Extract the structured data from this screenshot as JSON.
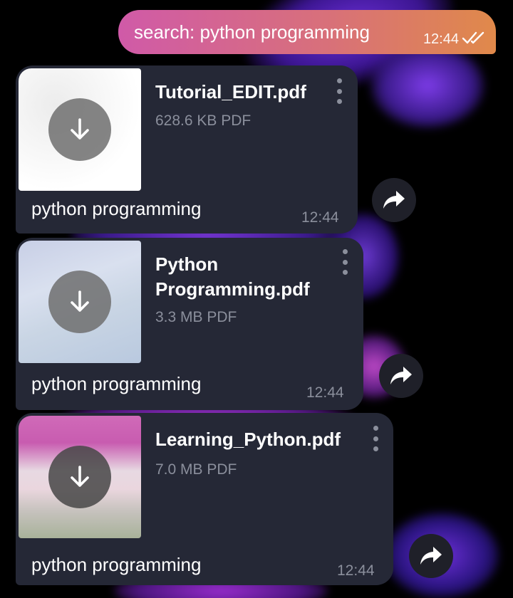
{
  "outgoing": {
    "text": "search: python programming",
    "time": "12:44",
    "status_icon": "double-check-icon"
  },
  "documents": [
    {
      "file_name": "Tutorial_EDIT.pdf",
      "file_info": "628.6 KB PDF",
      "caption": "python programming",
      "time": "12:44",
      "thumb_style": "white"
    },
    {
      "file_name_line1": "Python",
      "file_name_line2": "Programming.pdf",
      "file_info": "3.3 MB PDF",
      "caption": "python programming",
      "time": "12:44",
      "thumb_style": "light-blue"
    },
    {
      "file_name": "Learning_Python.pdf",
      "file_info": "7.0 MB PDF",
      "caption": "python programming",
      "time": "12:44",
      "thumb_style": "magenta"
    }
  ],
  "colors": {
    "bubble_bg": "#252836",
    "meta_text": "#8b8f9c",
    "outgoing_gradient_start": "#d05aa8",
    "outgoing_gradient_end": "#e0894a"
  }
}
